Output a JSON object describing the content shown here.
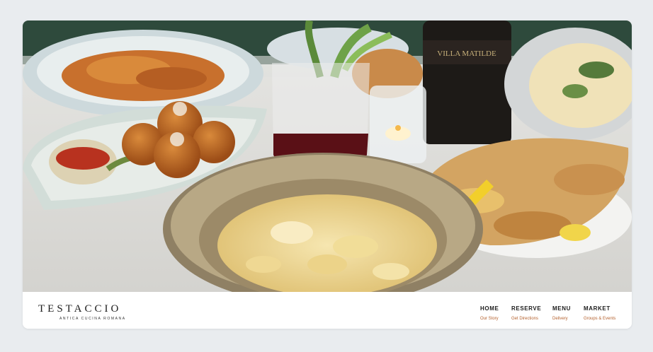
{
  "brand": {
    "name": "TESTACCIO",
    "tagline": "ANTICA CUCINA ROMANA"
  },
  "hero": {
    "wine_label": "VILLA MATILDE"
  },
  "nav": [
    {
      "label": "HOME",
      "sub": "Our Story"
    },
    {
      "label": "RESERVE",
      "sub": "Get Directions"
    },
    {
      "label": "MENU",
      "sub": "Delivery"
    },
    {
      "label": "MARKET",
      "sub": "Groups & Events"
    }
  ],
  "colors": {
    "page_bg": "#e9ecef",
    "accent": "#b5622f",
    "text": "#1b1b1b"
  }
}
